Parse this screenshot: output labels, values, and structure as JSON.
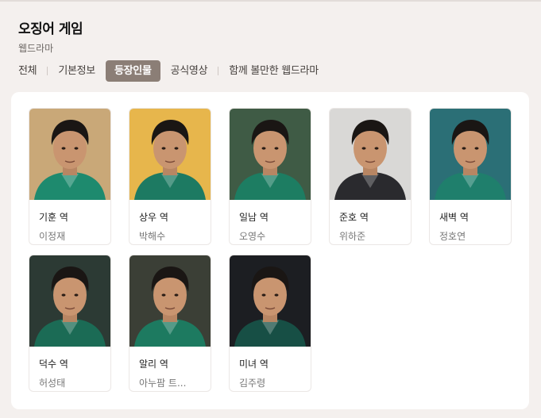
{
  "header": {
    "title": "오징어 게임",
    "subtitle": "웹드라마"
  },
  "tabs": [
    {
      "label": "전체",
      "active": false
    },
    {
      "label": "기본정보",
      "active": false
    },
    {
      "label": "등장인물",
      "active": true
    },
    {
      "label": "공식영상",
      "active": false
    },
    {
      "label": "함께 볼만한 웹드라마",
      "active": false
    }
  ],
  "cast": [
    {
      "role": "기훈 역",
      "actor": "이정재",
      "photo_bg": "#c9a878",
      "shirt": "#1e8a6e"
    },
    {
      "role": "상우 역",
      "actor": "박해수",
      "photo_bg": "#e7b64c",
      "shirt": "#1d7a62"
    },
    {
      "role": "일남 역",
      "actor": "오영수",
      "photo_bg": "#3f5b45",
      "shirt": "#1d7d62"
    },
    {
      "role": "준호 역",
      "actor": "위하준",
      "photo_bg": "#d9d8d6",
      "shirt": "#2a2a2e"
    },
    {
      "role": "새벽 역",
      "actor": "정호연",
      "photo_bg": "#2b6f76",
      "shirt": "#1f7f6c"
    },
    {
      "role": "덕수 역",
      "actor": "허성태",
      "photo_bg": "#2c3a34",
      "shirt": "#1b6b55"
    },
    {
      "role": "알리 역",
      "actor": "아누팜 트...",
      "photo_bg": "#3b3f36",
      "shirt": "#1d7a60"
    },
    {
      "role": "미녀 역",
      "actor": "김주령",
      "photo_bg": "#1c1e22",
      "shirt": "#174f45"
    }
  ]
}
